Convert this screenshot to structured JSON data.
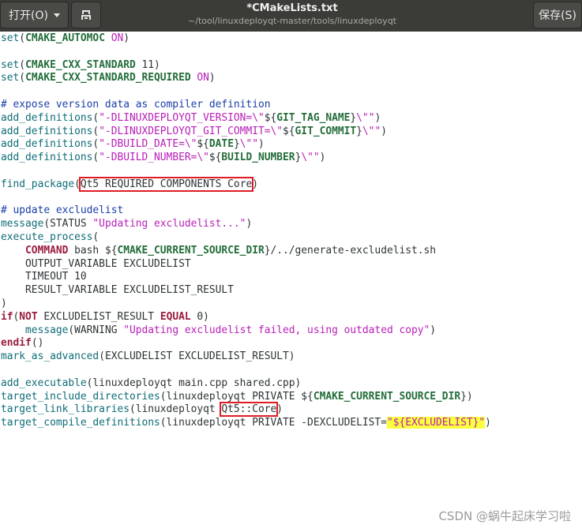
{
  "header": {
    "open_label": "打开(O)",
    "save_label": "保存(S)",
    "title": "*CMakeLists.txt",
    "subtitle": "~/tool/linuxdeployqt-master/tools/linuxdeployqt"
  },
  "editor": {
    "lines": [
      [
        [
          "fn",
          "set"
        ],
        [
          "p",
          "("
        ],
        [
          "var",
          "CMAKE_AUTOMOC"
        ],
        [
          "p",
          " "
        ],
        [
          "boolv",
          "ON"
        ],
        [
          "p",
          ")"
        ]
      ],
      [],
      [
        [
          "fn",
          "set"
        ],
        [
          "p",
          "("
        ],
        [
          "var",
          "CMAKE_CXX_STANDARD"
        ],
        [
          "p",
          " 11)"
        ]
      ],
      [
        [
          "fn",
          "set"
        ],
        [
          "p",
          "("
        ],
        [
          "var",
          "CMAKE_CXX_STANDARD_REQUIRED"
        ],
        [
          "p",
          " "
        ],
        [
          "boolv",
          "ON"
        ],
        [
          "p",
          ")"
        ]
      ],
      [],
      [
        [
          "cmt",
          "# expose version data as compiler definition"
        ]
      ],
      [
        [
          "fn",
          "add_definitions"
        ],
        [
          "p",
          "("
        ],
        [
          "str",
          "\"-DLINUXDEPLOYQT_VERSION=\\\""
        ],
        [
          "p",
          "${"
        ],
        [
          "var",
          "GIT_TAG_NAME"
        ],
        [
          "p",
          "}"
        ],
        [
          "str",
          "\\\"\""
        ],
        [
          "p",
          ")"
        ]
      ],
      [
        [
          "fn",
          "add_definitions"
        ],
        [
          "p",
          "("
        ],
        [
          "str",
          "\"-DLINUXDEPLOYQT_GIT_COMMIT=\\\""
        ],
        [
          "p",
          "${"
        ],
        [
          "var",
          "GIT_COMMIT"
        ],
        [
          "p",
          "}"
        ],
        [
          "str",
          "\\\"\""
        ],
        [
          "p",
          ")"
        ]
      ],
      [
        [
          "fn",
          "add_definitions"
        ],
        [
          "p",
          "("
        ],
        [
          "str",
          "\"-DBUILD_DATE=\\\""
        ],
        [
          "p",
          "${"
        ],
        [
          "var",
          "DATE"
        ],
        [
          "p",
          "}"
        ],
        [
          "str",
          "\\\"\""
        ],
        [
          "p",
          ")"
        ]
      ],
      [
        [
          "fn",
          "add_definitions"
        ],
        [
          "p",
          "("
        ],
        [
          "str",
          "\"-DBUILD_NUMBER=\\\""
        ],
        [
          "p",
          "${"
        ],
        [
          "var",
          "BUILD_NUMBER"
        ],
        [
          "p",
          "}"
        ],
        [
          "str",
          "\\\"\""
        ],
        [
          "p",
          ")"
        ]
      ],
      [],
      [
        [
          "fn",
          "find_package"
        ],
        [
          "p",
          "("
        ],
        [
          "box",
          "Qt5 REQUIRED COMPONENTS Core"
        ],
        [
          "p",
          ")"
        ]
      ],
      [],
      [
        [
          "cmt",
          "# update excludelist"
        ]
      ],
      [
        [
          "fn",
          "message"
        ],
        [
          "p",
          "(STATUS "
        ],
        [
          "str",
          "\"Updating excludelist...\""
        ],
        [
          "p",
          ")"
        ]
      ],
      [
        [
          "fn",
          "execute_process"
        ],
        [
          "p",
          "("
        ]
      ],
      [
        [
          "p",
          "    "
        ],
        [
          "kw",
          "COMMAND"
        ],
        [
          "p",
          " bash ${"
        ],
        [
          "var",
          "CMAKE_CURRENT_SOURCE_DIR"
        ],
        [
          "p",
          "}/../generate-excludelist.sh"
        ]
      ],
      [
        [
          "p",
          "    OUTPUT_VARIABLE EXCLUDELIST"
        ]
      ],
      [
        [
          "p",
          "    TIMEOUT 10"
        ]
      ],
      [
        [
          "p",
          "    RESULT_VARIABLE EXCLUDELIST_RESULT"
        ]
      ],
      [
        [
          "p",
          ")"
        ]
      ],
      [
        [
          "kw",
          "if"
        ],
        [
          "p",
          "("
        ],
        [
          "kw",
          "NOT"
        ],
        [
          "p",
          " EXCLUDELIST_RESULT "
        ],
        [
          "kw",
          "EQUAL"
        ],
        [
          "p",
          " 0)"
        ]
      ],
      [
        [
          "p",
          "    "
        ],
        [
          "fn",
          "message"
        ],
        [
          "p",
          "(WARNING "
        ],
        [
          "str",
          "\"Updating excludelist failed, using outdated copy\""
        ],
        [
          "p",
          ")"
        ]
      ],
      [
        [
          "kw",
          "endif"
        ],
        [
          "p",
          "()"
        ]
      ],
      [
        [
          "fn",
          "mark_as_advanced"
        ],
        [
          "p",
          "(EXCLUDELIST EXCLUDELIST_RESULT)"
        ]
      ],
      [],
      [
        [
          "fn",
          "add_executable"
        ],
        [
          "p",
          "(linuxdeployqt main.cpp shared.cpp)"
        ]
      ],
      [
        [
          "fn",
          "target_include_directories"
        ],
        [
          "p",
          "(linuxdeployqt PRIVATE ${"
        ],
        [
          "var",
          "CMAKE_CURRENT_SOURCE_DIR"
        ],
        [
          "p",
          "})"
        ]
      ],
      [
        [
          "fn",
          "target_link_libraries"
        ],
        [
          "p",
          "(linuxdeployqt "
        ],
        [
          "box",
          "Qt5::Core"
        ],
        [
          "p",
          ")"
        ]
      ],
      [
        [
          "fn",
          "target_compile_definitions"
        ],
        [
          "p",
          "(linuxdeployqt PRIVATE -DEXCLUDELIST="
        ],
        [
          "hlstr",
          "\"${EXCLUDELIST}\""
        ],
        [
          "p",
          ")"
        ]
      ]
    ]
  },
  "watermark": "CSDN @蜗牛起床学习啦",
  "colors": {
    "titlebar": "#3b3b38",
    "function": "#0e6c76",
    "keyword": "#9a1c3d",
    "variable": "#236d3a",
    "string": "#b81fb8",
    "comment": "#1a3ea9",
    "highlight": "#fbff3d",
    "annotation_box": "#e01b24"
  }
}
